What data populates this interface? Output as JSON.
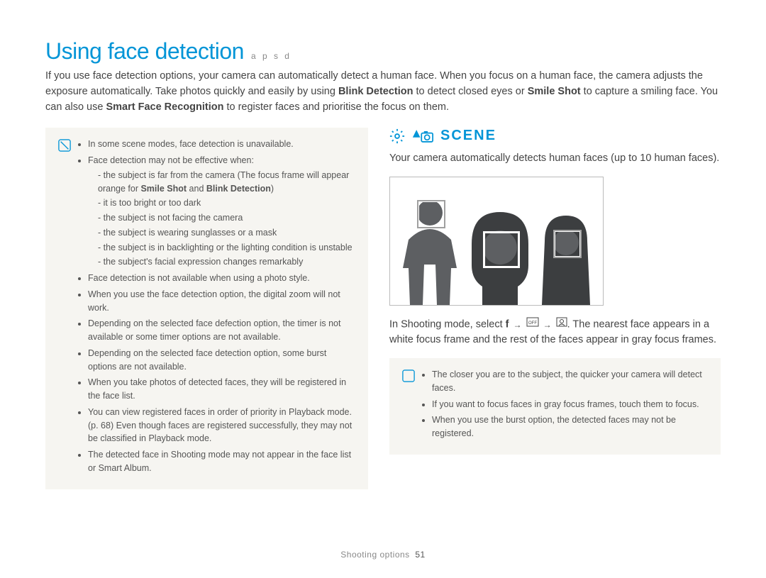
{
  "title": "Using face detection",
  "mode_letters": "a p s d",
  "intro_parts": {
    "p1": "If you use face detection options, your camera can automatically detect a human face. When you focus on a human face, the camera adjusts the exposure automatically. Take photos quickly and easily by using ",
    "b1": "Blink Detection",
    "p2": " to detect closed eyes or ",
    "b2": "Smile Shot",
    "p3": " to capture a smiling face. You can also use ",
    "b3": "Smart Face Recognition",
    "p4": " to register faces and prioritise the focus on them."
  },
  "left_notes": {
    "bullet1": "In some scene modes, face detection is unavailable.",
    "bullet2": "Face detection may not be effective when:",
    "sub2": {
      "a_pre": "the subject is far from the camera (The focus frame will appear orange for ",
      "a_b1": "Smile Shot",
      "a_mid": " and ",
      "a_b2": "Blink Detection",
      "a_suf": ")",
      "b": "it is too bright or too dark",
      "c": "the subject is not facing the camera",
      "d": "the subject is wearing sunglasses or a mask",
      "e": "the subject is in backlighting or the lighting condition is unstable",
      "f": "the subject's facial expression changes remarkably"
    },
    "bullet3": "Face detection is not available when using a photo style.",
    "bullet4": "When you use the face detection option, the digital zoom will not work.",
    "bullet5": "Depending on the selected face defection option, the timer is not available or some timer options are not available.",
    "bullet6": "Depending on the selected face detection option, some burst options are not available.",
    "bullet7": "When you take photos of detected faces, they will be registered in the face list.",
    "bullet8": "You can view registered faces in order of priority in Playback mode. (p. 68) Even though faces are registered successfully, they may not be classified in Playback mode.",
    "bullet9": "The detected face in Shooting mode may not appear in the face list or Smart Album."
  },
  "right": {
    "scene_label": "SCENE",
    "detect_text": "Your camera automatically detects human faces (up to 10 human faces).",
    "instruct": {
      "p1": "In Shooting mode, select ",
      "b1": "f",
      "arrow": "→",
      "p2": ". The nearest face appears in a white focus frame and the rest of the faces appear in gray focus frames."
    }
  },
  "right_notes": {
    "b1": "The closer you are to the subject, the quicker your camera will detect faces.",
    "b2": "If you want to focus faces in gray focus frames, touch them to focus.",
    "b3": "When you use the burst option, the detected faces may not be registered."
  },
  "footer": {
    "section": "Shooting options",
    "page": "51"
  }
}
